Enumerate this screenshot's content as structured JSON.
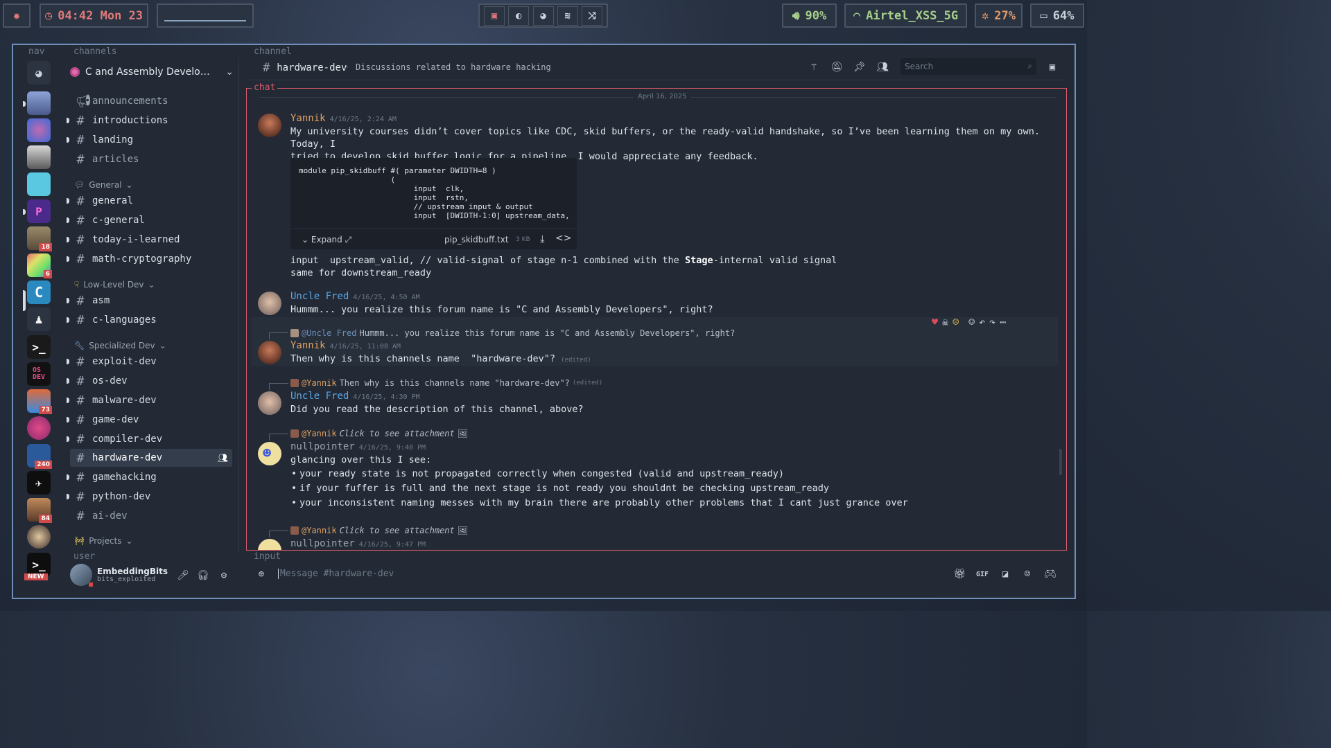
{
  "topbar": {
    "clock": "04:42 Mon 23",
    "volume": "90%",
    "wifi": "Airtel_XSS_5G",
    "cpu": "27%",
    "battery": "64%"
  },
  "labels": {
    "nav": "nav",
    "channels": "channels",
    "channel": "channel",
    "chat": "chat",
    "user": "user",
    "input": "input"
  },
  "nav": {
    "badges": [
      "18",
      "6",
      "73",
      "240",
      "84"
    ],
    "new_label": "NEW"
  },
  "server": {
    "name": "C and Assembly Develo…"
  },
  "channels": {
    "items": [
      {
        "name": "announcements"
      },
      {
        "name": "introductions"
      },
      {
        "name": "landing"
      },
      {
        "name": "articles"
      },
      {
        "name": "general"
      },
      {
        "name": "c-general"
      },
      {
        "name": "today-i-learned"
      },
      {
        "name": "math-cryptography"
      },
      {
        "name": "asm"
      },
      {
        "name": "c-languages"
      },
      {
        "name": "exploit-dev"
      },
      {
        "name": "os-dev"
      },
      {
        "name": "malware-dev"
      },
      {
        "name": "game-dev"
      },
      {
        "name": "compiler-dev"
      },
      {
        "name": "hardware-dev"
      },
      {
        "name": "gamehacking"
      },
      {
        "name": "python-dev"
      },
      {
        "name": "ai-dev"
      }
    ],
    "categories": [
      "General",
      "Low-Level Dev",
      "Specialized Dev",
      "Projects"
    ]
  },
  "user": {
    "name": "EmbeddingBits",
    "tag": "bits_exploited"
  },
  "header": {
    "channel_name": "hardware-dev",
    "description": "Discussions related to hardware hacking",
    "search_placeholder": "Search"
  },
  "chat": {
    "date": "April 16, 2025",
    "messages": [
      {
        "author": "Yannik",
        "time": "4/16/25, 2:24 AM",
        "text": "My university courses didn’t cover topics like CDC, skid buffers, or the ready-valid handshake, so I’ve been learning them on my own. Today, I\ntried to develop skid buffer logic for a pipeline. I would appreciate any feedback.",
        "code": "module pip_skidbuff #( parameter DWIDTH=8 )\n                    (\n                         input  clk,\n                         input  rstn,\n                         // upstream input & output\n                         input  [DWIDTH-1:0] upstream_data,",
        "expand": "Expand",
        "file": "pip_skidbuff.txt",
        "file_size": "3 KB",
        "after_code_1": "input  upstream_valid, // valid-signal of stage n-1 combined with the ",
        "after_code_bold": "Stage",
        "after_code_2": "-internal valid signal",
        "after_code_3": "same for downstream_ready"
      },
      {
        "author": "Uncle Fred",
        "time": "4/16/25, 4:50 AM",
        "text": "Hummm... you realize this forum name is \"C and Assembly Developers\", right?"
      },
      {
        "reply_to": "@Uncle Fred",
        "reply_text": "Hummm... you realize this forum name is \"C and Assembly Developers\", right?",
        "author": "Yannik",
        "time": "4/16/25, 11:08 AM",
        "text": "Then why is this channels name  \"hardware-dev\"?",
        "edited": "(edited)"
      },
      {
        "reply_to": "@Yannik",
        "reply_text": "Then why is this channels name  \"hardware-dev\"?",
        "reply_edited": "(edited)",
        "author": "Uncle Fred",
        "time": "4/16/25, 4:30 PM",
        "text": "Did you read the description of this channel, above?"
      },
      {
        "reply_to": "@Yannik",
        "reply_text": "Click to see attachment",
        "author": "nullpointer",
        "time": "4/16/25, 9:40 PM",
        "text": "glancing over this I see:",
        "bullets": [
          "your ready state is not propagated correctly when congested (valid and upstream_ready)",
          "if your fuffer is full and the next stage is not ready you shouldnt be checking upstream_ready",
          "your inconsistent naming messes with my brain there are probably other problems that I cant just grance over"
        ]
      },
      {
        "reply_to": "@Yannik",
        "reply_text": "Click to see attachment",
        "author": "nullpointer",
        "time": "4/16/25, 9:47 PM"
      }
    ]
  },
  "input": {
    "placeholder": "Message #hardware-dev"
  },
  "colors": {
    "accent_frame": "#6d8fb8",
    "chat_border": "#d95a6a",
    "author_yannik": "#e0a060",
    "author_fred": "#5aa8e8",
    "author_null": "#9aa4b2"
  }
}
